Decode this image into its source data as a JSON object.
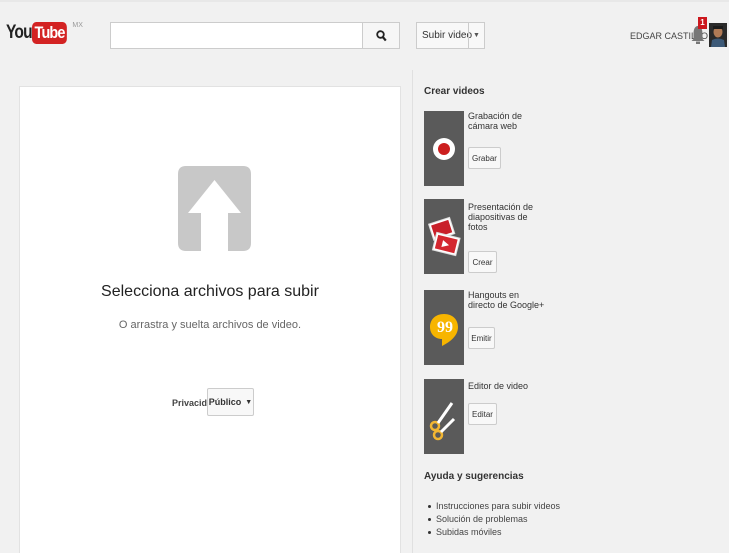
{
  "header": {
    "logo_you": "You",
    "logo_tube": "Tube",
    "logo_region": "MX",
    "search_placeholder": "",
    "upload_label": "Subir video",
    "user_name": "EDGAR CASTILLO",
    "notification_count": "1"
  },
  "upload": {
    "title": "Selecciona archivos para subir",
    "subtitle": "O arrastra y suelta archivos de video.",
    "privacy_label": "Privacidad:",
    "privacy_value": "Público"
  },
  "sidebar": {
    "title": "Crear videos",
    "tools": [
      {
        "name": "Grabación de cámara web",
        "button": "Grabar"
      },
      {
        "name": "Presentación de diapositivas de fotos",
        "button": "Crear"
      },
      {
        "name": "Hangouts en directo de Google+",
        "button": "Emitir"
      },
      {
        "name": "Editor de video",
        "button": "Editar"
      }
    ],
    "help_title": "Ayuda y sugerencias",
    "help_links": [
      "Instrucciones para subir videos",
      "Solución de problemas",
      "Subidas móviles"
    ]
  },
  "colors": {
    "brand_red": "#d32323",
    "hangouts_yellow": "#f7b500",
    "editor_yellow": "#f2b632",
    "panel_bg": "#ffffff",
    "page_bg": "#f1f1f1"
  }
}
